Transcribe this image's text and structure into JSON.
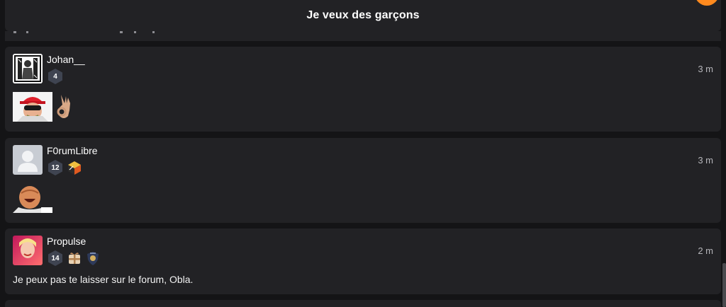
{
  "topic": {
    "title": "Je veux des garçons"
  },
  "colors": {
    "background": "#141416",
    "card": "#222225",
    "accent": "#ff8a1e",
    "badge": "#3f4451"
  },
  "posts": [
    {
      "username": "Johan__",
      "level": "4",
      "time": "3 m",
      "avatar_icon": "sketch-avatar-icon",
      "badges": [],
      "stickers": [
        "red-cap-sticker",
        "ok-hand-emoji"
      ],
      "message": ""
    },
    {
      "username": "F0rumLibre",
      "level": "12",
      "time": "3 m",
      "avatar_icon": "default-user-avatar-icon",
      "badges": [
        "cube-badge-icon"
      ],
      "stickers": [
        "laughing-man-sticker"
      ],
      "message": ""
    },
    {
      "username": "Propulse",
      "level": "14",
      "time": "2 m",
      "avatar_icon": "photo-avatar-icon",
      "badges": [
        "gift-badge-icon",
        "shield-badge-icon"
      ],
      "stickers": [],
      "message": "Je peux pas te laisser sur le forum, Obla."
    }
  ]
}
